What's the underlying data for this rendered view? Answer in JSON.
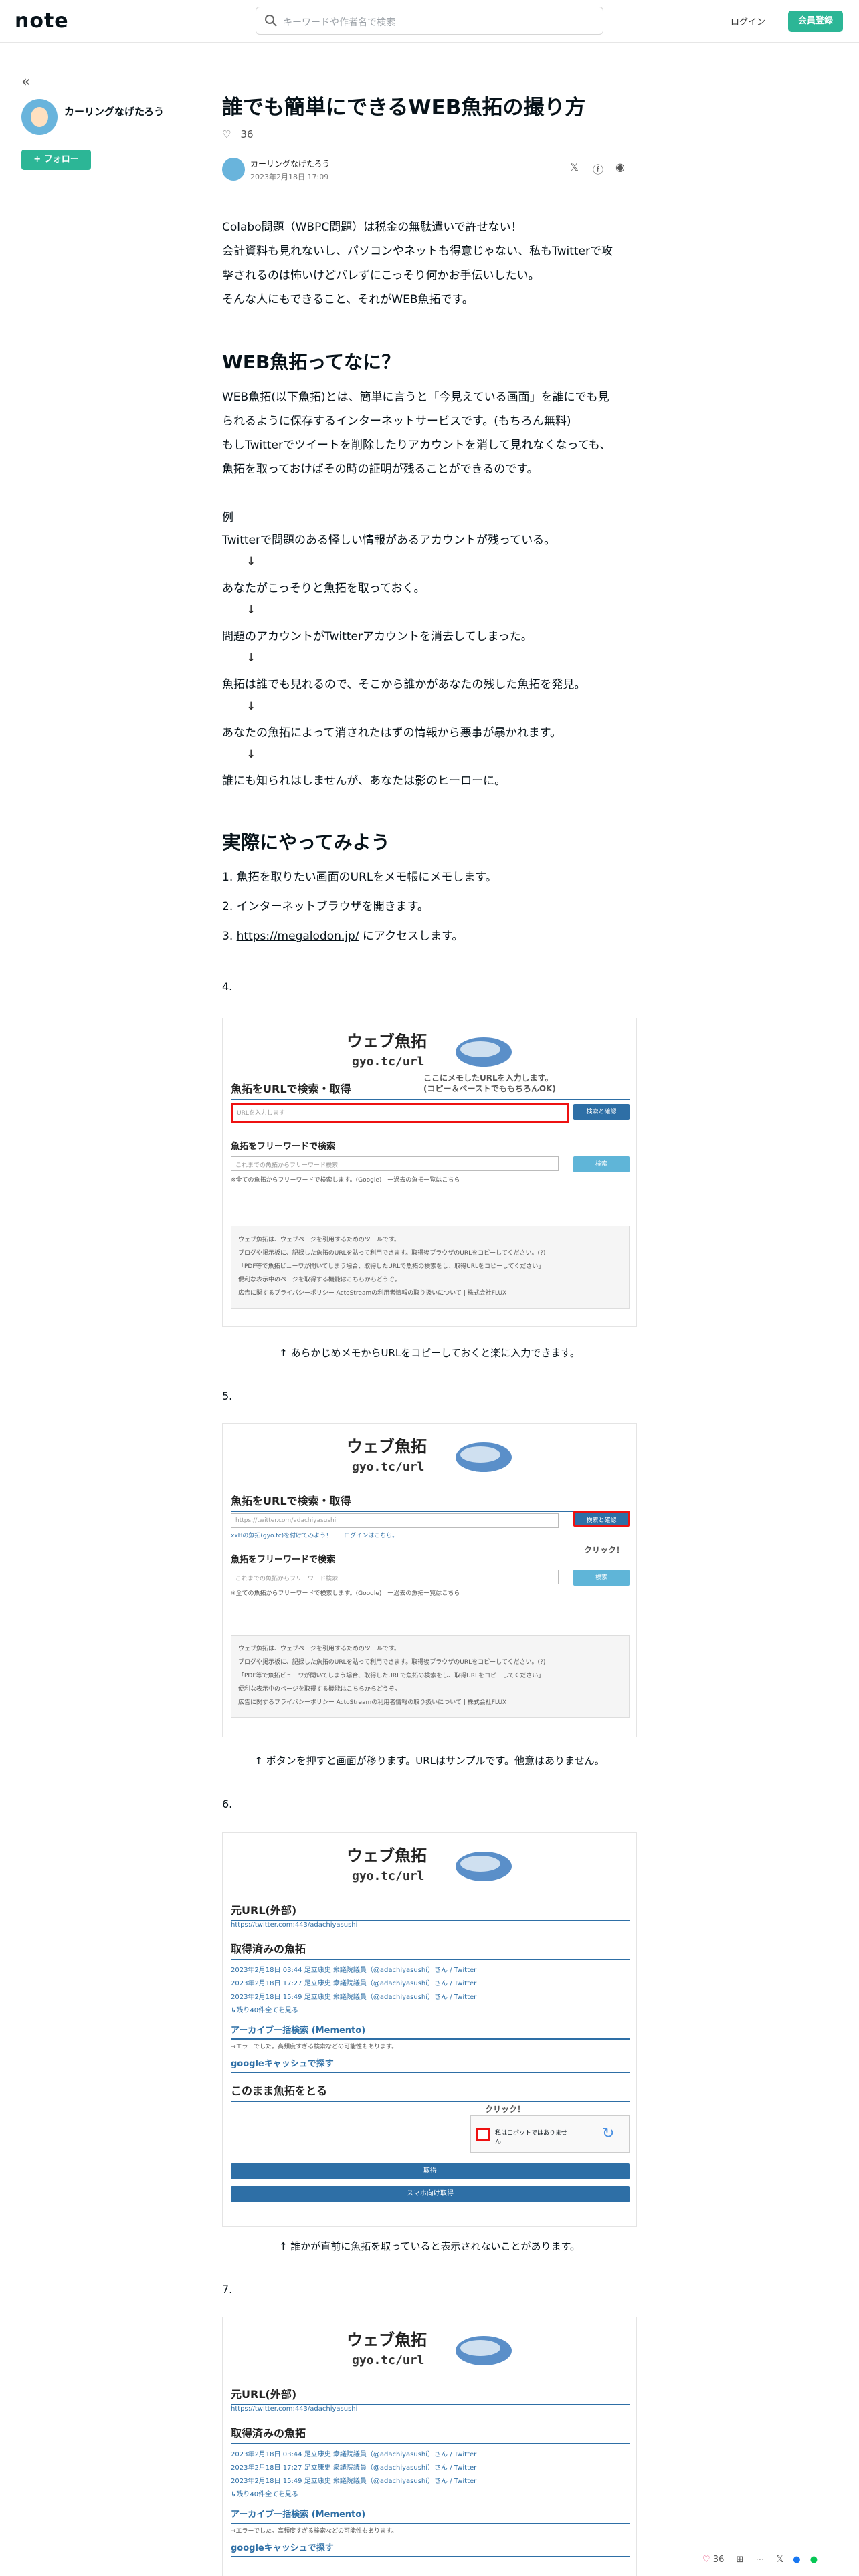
{
  "header": {
    "logo": "note",
    "search_placeholder": "キーワードや作者名で検索",
    "login": "ログイン",
    "signup": "会員登録"
  },
  "sidebar": {
    "collapse": "«",
    "name": "カーリングなげたろう",
    "follow": "+ フォロー"
  },
  "article": {
    "title": "誰でも簡単にできるWEB魚拓の撮り方",
    "likes": "36",
    "author": "カーリングなげたろう",
    "date": "2023年2月18日 17:09",
    "intro": [
      "Colabo問題（WBPC問題）は税金の無駄遣いで許せない！",
      "会計資料も見れないし、パソコンやネットも得意じゃない、私もTwitterで攻",
      "撃されるのは怖いけどバレずにこっそり何かお手伝いしたい。",
      "そんな人にもできること、それがWEB魚拓です。"
    ],
    "h2_1": "WEB魚拓ってなに？",
    "what": [
      "WEB魚拓(以下魚拓)とは、簡単に言うと「今見えている画面」を誰にでも見",
      "られるように保存するインターネットサービスです。(もちろん無料)",
      "もしTwitterでツイートを削除したりアカウントを消して見れなくなっても、",
      "魚拓を取っておけばその時の証明が残ることができるのです。"
    ],
    "example_label": "例",
    "example": [
      "Twitterで問題のある怪しい情報があるアカウントが残っている。",
      "あなたがこっそりと魚拓を取っておく。",
      "問題のアカウントがTwitterアカウントを消去してしまった。",
      "魚拓は誰でも見れるので、そこから誰かがあなたの残した魚拓を発見。",
      "あなたの魚拓によって消されたはずの情報から悪事が暴かれます。",
      "誰にも知られはしませんが、あなたは影のヒーローに。"
    ],
    "arrow": "↓",
    "h2_2": "実際にやってみよう",
    "steps": [
      "1. 魚拓を取りたい画面のURLをメモ帳にメモします。",
      "2. インターネットブラウザを開きます。",
      "3. "
    ],
    "link": "https://megalodon.jp/",
    "link_suffix": " にアクセスします。",
    "num4": "4.",
    "num5": "5.",
    "num6": "6.",
    "num7": "7.",
    "cap4": "↑ あらかじめメモからURLをコピーしておくと楽に入力できます。",
    "cap5": "↑ ボタンを押すと画面が移ります。URLはサンプルです。他意はありません。",
    "cap6": "↑ 誰かが直前に魚拓を取っていると表示されないことがあります。"
  },
  "gyotaku": {
    "logo_text": "ウェブ魚拓",
    "domain": "gyo.tc/url",
    "search_url": "魚拓をURLで検索・取得",
    "url_placeholder": "URLを入力します",
    "btn_search": "検索と確認",
    "search_word": "魚拓をフリーワードで検索",
    "word_placeholder": "これまでの魚拓からフリーワード検索",
    "btn_word": "検索",
    "word_note": "※全ての魚拓からフリーワードで検索します。(Google)　一過去の魚拓一覧はこちら",
    "annot4a": "ここにメモしたURLを入力します。",
    "annot4b": "(コピー＆ペーストでももちろんOK)",
    "info": [
      "ウェブ魚拓は、ウェブページを引用するためのツールです。",
      "ブログや掲示板に、記録した魚拓のURLを貼って利用できます。取得後ブラウザのURLをコピーしてください。(?)",
      "「PDF等で魚拓ビューワが開いてしまう場合、取得したURLで魚拓の検索をし、取得URLをコピーしてください」",
      "便利な表示中のページを取得する機能はこちらからどうぞ。",
      "広告に関するプライバシーポリシー ActoStreamの利用者情報の取り扱いについて | 株式会社FLUX"
    ],
    "url5": "https://twitter.com/adachiyasushi",
    "url5_note": "xxHの魚拓(gyo.tc)を付けてみよう！　ーログインはこちら。",
    "click": "クリック！",
    "origin": "元URL(外部)",
    "origin_url": "https://twitter.com:443/adachiyasushi",
    "got": "取得済みの魚拓",
    "rows": [
      "2023年2月18日 03:44 足立康史 衆議院議員（@adachiyasushi）さん / Twitter",
      "2023年2月18日 17:27 足立康史 衆議院議員（@adachiyasushi）さん / Twitter",
      "2023年2月18日 15:49 足立康史 衆議院議員（@adachiyasushi）さん / Twitter"
    ],
    "more": "↳残り40件全てを見る",
    "archive": "アーカイブ一括検索 (Memento)",
    "archive_note": "→エラーでした。高頻度すぎる検索などの可能性もあります。",
    "google": "googleキャッシュで探す",
    "take": "このまま魚拓をとる",
    "robot": "私はロボットではありません",
    "get": "取得",
    "get_sp": "スマホ向け取得"
  },
  "bottom": {
    "likes": "36"
  }
}
